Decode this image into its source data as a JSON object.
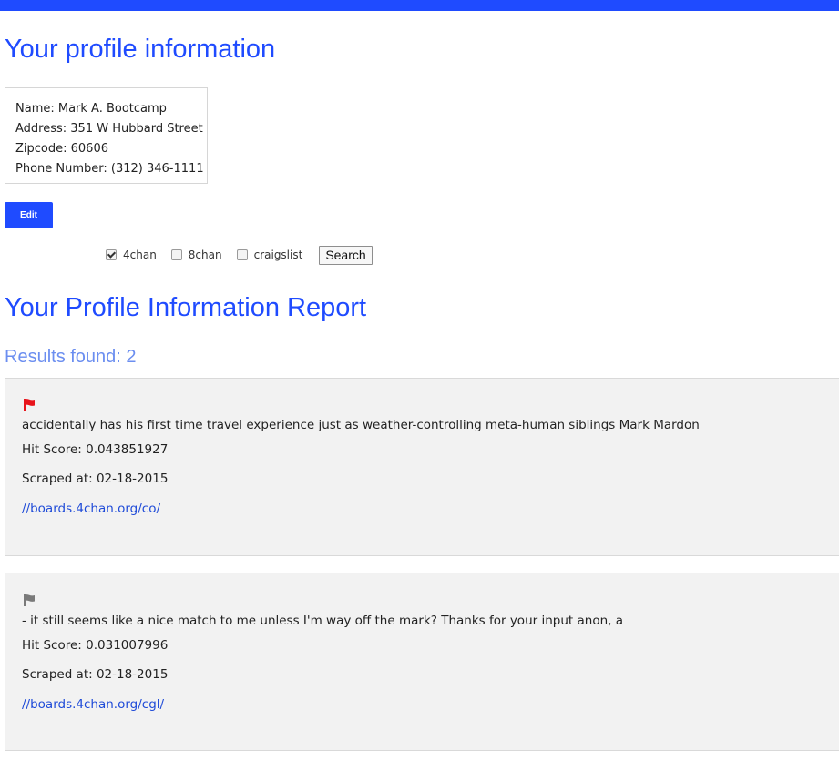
{
  "colors": {
    "accent": "#1f4bff",
    "results_heading": "#6b8ef0",
    "card_background": "#f2f2f2",
    "flag_active": "#e8141b",
    "flag_inactive": "#7a7a7a",
    "link": "#1f4bd8"
  },
  "profile": {
    "title": "Your profile information",
    "name": "Name: Mark A. Bootcamp",
    "address": "Address: 351 W Hubbard Street",
    "zipcode": "Zipcode: 60606",
    "phone": "Phone Number: (312) 346-1111",
    "edit_label": "Edit"
  },
  "filters": {
    "sources": [
      {
        "label": "4chan",
        "checked": true
      },
      {
        "label": "8chan",
        "checked": false
      },
      {
        "label": "craigslist",
        "checked": false
      }
    ],
    "search_label": "Search"
  },
  "report": {
    "title": "Your Profile Information Report",
    "results_count": "Results found: 2",
    "results": [
      {
        "flag_icon": "flag-icon",
        "flagged": true,
        "snippet": "accidentally has his first time travel experience just as weather-controlling meta-human siblings Mark Mardon",
        "hit_score": "Hit Score: 0.043851927",
        "scraped_at": "Scraped at: 02-18-2015",
        "link": "//boards.4chan.org/co/"
      },
      {
        "flag_icon": "flag-icon",
        "flagged": false,
        "snippet": "- it still seems like a nice match to me unless I'm way off the mark? Thanks for your input anon, a",
        "hit_score": "Hit Score: 0.031007996",
        "scraped_at": "Scraped at: 02-18-2015",
        "link": "//boards.4chan.org/cgl/"
      }
    ]
  }
}
